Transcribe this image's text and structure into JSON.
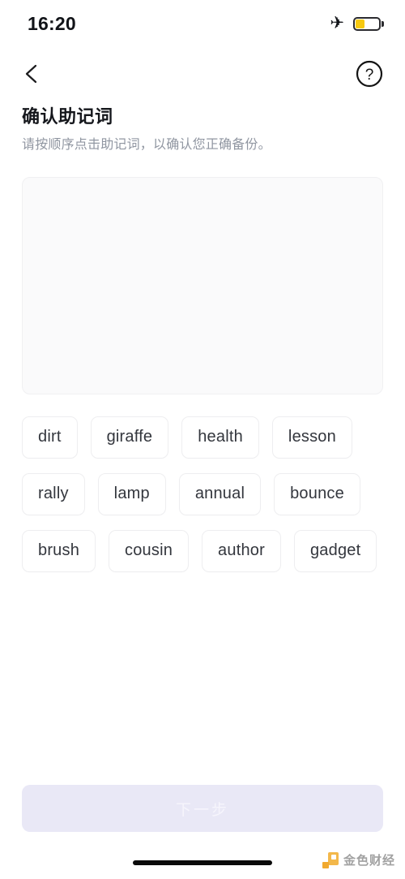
{
  "status_bar": {
    "time": "16:20",
    "airplane_icon": "airplane-mode-icon",
    "battery_icon": "battery-icon",
    "battery_level_percent": 40,
    "battery_color": "#F7C910"
  },
  "nav": {
    "back_icon": "chevron-left-icon",
    "help_icon": "help-circle-icon"
  },
  "header": {
    "title": "确认助记词",
    "subtitle": "请按顺序点击助记词，以确认您正确备份。"
  },
  "answer_panel": {
    "selected_words": [],
    "background": "#fafafb"
  },
  "word_bank": {
    "words": [
      "dirt",
      "giraffe",
      "health",
      "lesson",
      "rally",
      "lamp",
      "annual",
      "bounce",
      "brush",
      "cousin",
      "author",
      "gadget"
    ]
  },
  "footer": {
    "next_label": "下一步",
    "next_enabled": false,
    "next_background": "#e9e8f6"
  },
  "watermark": {
    "text": "金色财经",
    "logo_color": "#F2B23C"
  }
}
